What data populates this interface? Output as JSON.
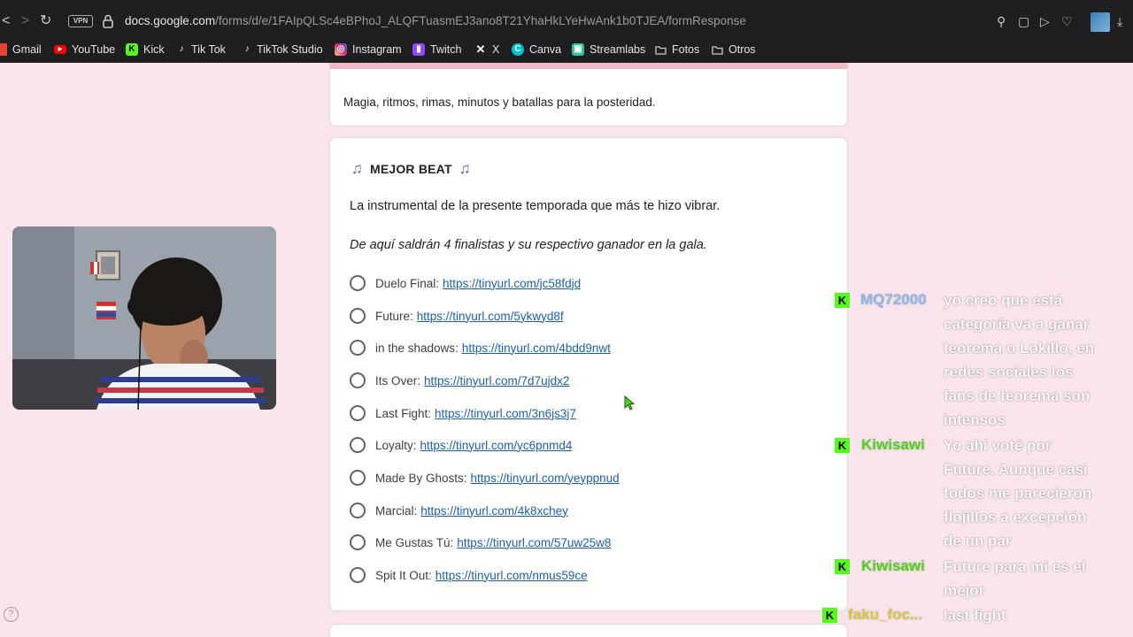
{
  "browser": {
    "back_label": "<",
    "forward_label": ">",
    "reload_label": "↻",
    "vpn_label": "VPN",
    "url_host": "docs.google.com",
    "url_path": "/forms/d/e/1FAIpQLSc4eBPhoJ_ALQFTuasmEJ3ano8T21YhaHkLYeHwAnk1b0TJEA/formResponse",
    "bookmarks": [
      {
        "label": "Gmail",
        "icon": "gmail-icon",
        "color": "#ea4335"
      },
      {
        "label": "YouTube",
        "icon": "youtube-icon",
        "color": "#ff0000"
      },
      {
        "label": "Kick",
        "icon": "kick-icon",
        "color": "#53fc18"
      },
      {
        "label": "Tik Tok",
        "icon": "tiktok-icon",
        "color": "#ffffff"
      },
      {
        "label": "TikTok Studio",
        "icon": "tiktok-icon",
        "color": "#ffffff"
      },
      {
        "label": "Instagram",
        "icon": "instagram-icon",
        "color": "#d62976"
      },
      {
        "label": "Twitch",
        "icon": "twitch-icon",
        "color": "#9146ff"
      },
      {
        "label": "X",
        "icon": "x-icon",
        "color": "#ffffff"
      },
      {
        "label": "Canva",
        "icon": "canva-icon",
        "color": "#00c4cc"
      },
      {
        "label": "Streamlabs",
        "icon": "streamlabs-icon",
        "color": "#31c3a2"
      },
      {
        "label": "Fotos",
        "icon": "folder-icon",
        "color": "#c9c9cc"
      },
      {
        "label": "Otros",
        "icon": "folder-icon",
        "color": "#c9c9cc"
      }
    ]
  },
  "form": {
    "description": "Magia, ritmos, rimas, minutos y batallas para la posteridad.",
    "question": {
      "title": "MEJOR BEAT",
      "subtitle": "La instrumental de la presente temporada que más te hizo vibrar.",
      "italic_note": "De aquí saldrán 4 finalistas y su respectivo ganador en la gala.",
      "options": [
        {
          "label": "Duelo Final:",
          "link": "https://tinyurl.com/jc58fdjd"
        },
        {
          "label": "Future:",
          "link": "https://tinyurl.com/5ykwyd8f"
        },
        {
          "label": "in the shadows:",
          "link": "https://tinyurl.com/4bdd9nwt"
        },
        {
          "label": "Its Over:",
          "link": "https://tinyurl.com/7d7ujdx2"
        },
        {
          "label": "Last Fight:",
          "link": "https://tinyurl.com/3n6js3j7"
        },
        {
          "label": "Loyalty:",
          "link": "https://tinyurl.com/yc6pnmd4"
        },
        {
          "label": "Made By Ghosts:",
          "link": "https://tinyurl.com/yeyppnud"
        },
        {
          "label": "Marcial:",
          "link": "https://tinyurl.com/4k8xchey"
        },
        {
          "label": "Me Gustas Tú:",
          "link": "https://tinyurl.com/57uw25w8"
        },
        {
          "label": "Spit It Out:",
          "link": "https://tinyurl.com/nmus59ce"
        }
      ]
    }
  },
  "help_label": "?",
  "chat": [
    {
      "user": "MQ72000",
      "user_color": "#8fb5e6",
      "lines": [
        "yo creo que está",
        "categoría va a ganar",
        "teorema o Lokillo, en",
        "redes sociales los",
        "fans de teorema son",
        "intensos"
      ]
    },
    {
      "user": "Kiwisawi",
      "user_color": "#53d11f",
      "lines": [
        "Yo ahí voté por",
        "Future. Aunque casi",
        "todos me parecieron",
        "flojillos a excepción",
        "de un par"
      ]
    },
    {
      "user": "Kiwisawi",
      "user_color": "#53d11f",
      "lines": [
        "Future para mi es el",
        "mejor"
      ]
    },
    {
      "user": "faku_foc...",
      "user_color": "#d6c94a",
      "lines": [
        "last fight"
      ]
    }
  ]
}
